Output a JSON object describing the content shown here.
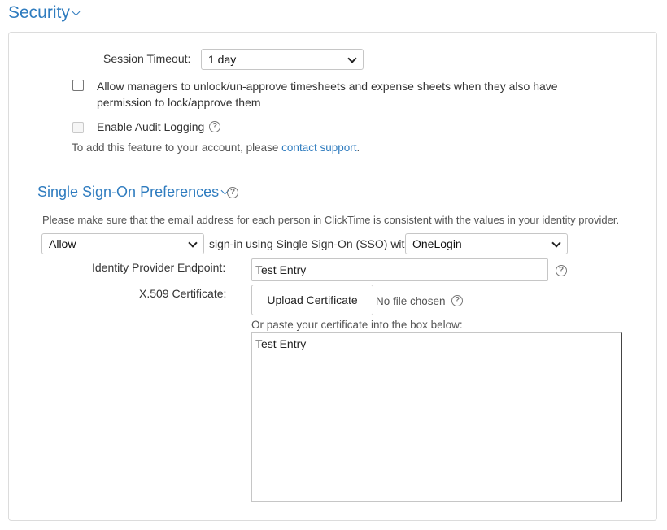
{
  "section": {
    "title": "Security"
  },
  "session_timeout": {
    "label": "Session Timeout:",
    "value": "1 day"
  },
  "allow_managers": {
    "checked": false,
    "line1": "Allow managers to unlock/un-approve timesheets and expense sheets when they also have",
    "line2": "permission to lock/approve them"
  },
  "audit_logging": {
    "checked": false,
    "disabled": true,
    "label": "Enable Audit Logging",
    "note_prefix": "To add this feature to your account, please ",
    "note_link": "contact support",
    "note_suffix": "."
  },
  "sso": {
    "title": "Single Sign-On Preferences",
    "notice": "Please make sure that the email address for each person in ClickTime is consistent with the values in your identity provider.",
    "allow_select": "Allow",
    "middle_text": "sign-in using Single Sign-On (SSO) with",
    "provider_select": "OneLogin",
    "endpoint_label": "Identity Provider Endpoint:",
    "endpoint_value": "Test Entry",
    "cert_label": "X.509 Certificate:",
    "upload_button": "Upload Certificate",
    "no_file": "No file chosen",
    "paste_hint": "Or paste your certificate into the box below:",
    "cert_text": "Test Entry"
  }
}
